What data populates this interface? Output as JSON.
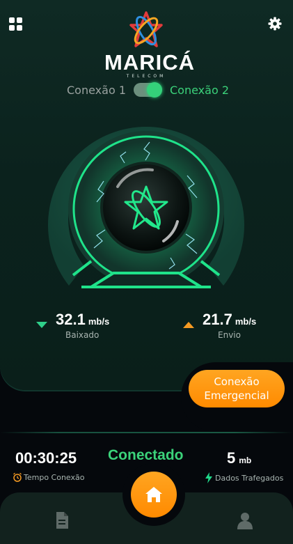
{
  "header": {
    "brand": "MARICÁ",
    "brand_sub": "TELECOM",
    "menu_icon": "grid-icon",
    "settings_icon": "gear-icon"
  },
  "connection_switch": {
    "option1": "Conexão 1",
    "option2": "Conexão 2",
    "selected": "Conexão 2"
  },
  "speeds": {
    "download": {
      "value": "32.1",
      "unit": "mb/s",
      "label": "Baixado"
    },
    "upload": {
      "value": "21.7",
      "unit": "mb/s",
      "label": "Envio"
    }
  },
  "emergency_button": {
    "label": "Conexão Emergencial"
  },
  "stats": {
    "time": {
      "value": "00:30:25",
      "label": "Tempo Conexão",
      "icon": "alarm-clock-icon"
    },
    "status": "Conectado",
    "data": {
      "value": "5",
      "unit": "mb",
      "label": "Dados Trafegados",
      "icon": "lightning-icon"
    }
  },
  "nav": {
    "items": [
      "document-icon",
      "home-icon",
      "user-icon"
    ]
  },
  "colors": {
    "accent_green": "#3bd27a",
    "accent_orange": "#ff9a14",
    "panel": "#0f2a24",
    "background": "#05080c"
  }
}
